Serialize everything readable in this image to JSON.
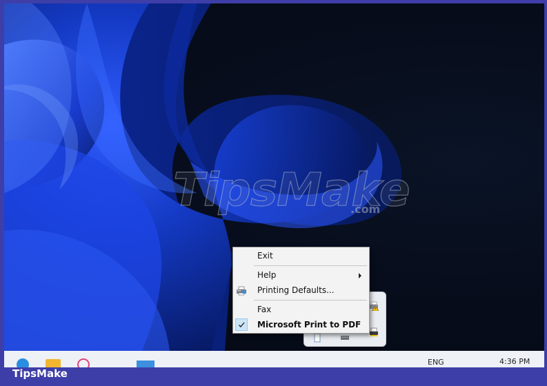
{
  "watermark": {
    "brand": "TipsMake",
    "suffix": ".com"
  },
  "context_menu": {
    "items": [
      {
        "label": "Exit",
        "icon": "none",
        "checked": false,
        "submenu": false,
        "bold": false
      },
      {
        "label": "Help",
        "icon": "none",
        "checked": false,
        "submenu": true,
        "bold": false
      },
      {
        "label": "Printing Defaults...",
        "icon": "printer-settings-icon",
        "checked": false,
        "submenu": false,
        "bold": false
      },
      {
        "label": "Fax",
        "icon": "none",
        "checked": false,
        "submenu": false,
        "bold": false
      },
      {
        "label": "Microsoft Print to PDF",
        "icon": "checkmark-icon",
        "checked": true,
        "submenu": false,
        "bold": true
      }
    ]
  },
  "tray_flyout": {
    "icons": [
      "printer-warning-icon",
      "printer-icon",
      "document-icon",
      "keyboard-icon"
    ]
  },
  "taskbar": {
    "language": "ENG",
    "clock": "4:36 PM"
  },
  "footer": {
    "brand": "TipsMake"
  },
  "colors": {
    "frame": "#3e3ea8",
    "menu_background": "#f3f3f3",
    "check_highlight": "#cce4f7",
    "wallpaper_blue": "#1a3fd6"
  }
}
